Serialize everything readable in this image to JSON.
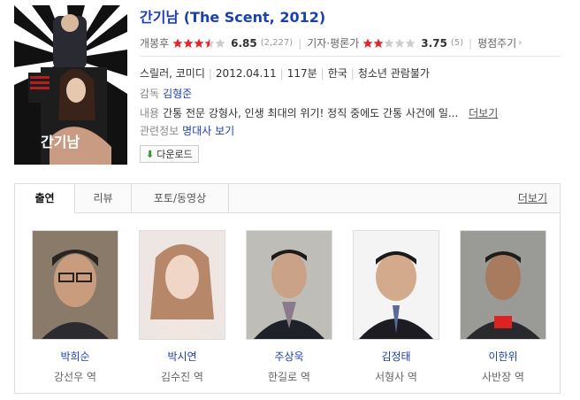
{
  "movie": {
    "title": "간기남 (The Scent, 2012)",
    "poster_title": "간기남"
  },
  "ratings": {
    "netizen_label": "개봉후",
    "netizen_score": "6.85",
    "netizen_count": "(2,227)",
    "netizen_stars": 3.5,
    "critic_label": "기자·평론가",
    "critic_score": "3.75",
    "critic_count": "(5)",
    "critic_stars": 2,
    "write_label": "평점주기"
  },
  "info": {
    "genre": "스릴러, 코미디",
    "release": "2012.04.11",
    "runtime": "117분",
    "country": "한국",
    "grade": "청소년 관람불가",
    "director_label": "감독",
    "director": "김형준",
    "plot_label": "내용",
    "plot": "간통 전문 강형사, 인생 최대의 위기! 정직 중에도 간통 사건에 일...",
    "plot_more": "더보기",
    "related_label": "관련정보",
    "related_link": "명대사 보기"
  },
  "download": {
    "label": "다운로드"
  },
  "tabs": {
    "items": [
      "출연",
      "리뷰",
      "포토/동영상"
    ],
    "more": "더보기"
  },
  "cast": [
    {
      "name": "박희순",
      "role": "강선우 역"
    },
    {
      "name": "박시연",
      "role": "김수진 역"
    },
    {
      "name": "주상욱",
      "role": "한길로 역"
    },
    {
      "name": "김정태",
      "role": "서형사 역"
    },
    {
      "name": "이한위",
      "role": "사반장 역"
    }
  ],
  "colors": {
    "link": "#1a3fb4",
    "star_on": "#e8232e",
    "star_off": "#cccccc"
  }
}
